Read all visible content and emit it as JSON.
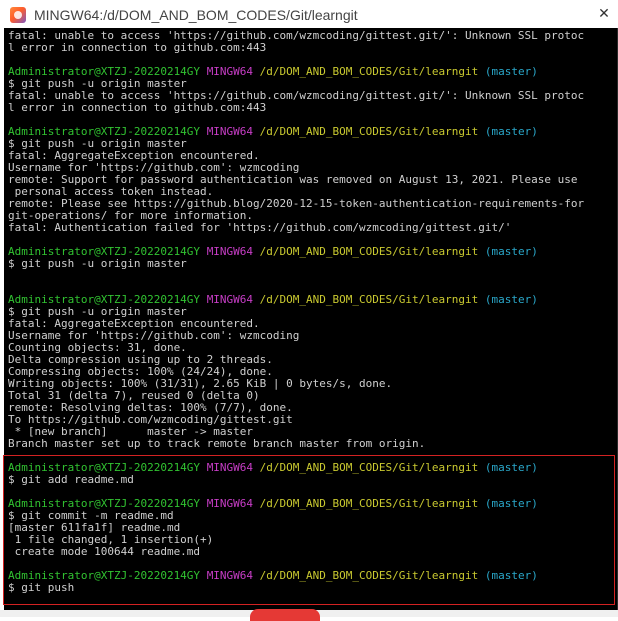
{
  "window": {
    "title": "MINGW64:/d/DOM_AND_BOM_CODES/Git/learngit",
    "close_symbol": "✕"
  },
  "highlight_color": "#d32222",
  "terminal_lines": [
    {
      "text": "fatal: unable to access 'https://github.com/wzmcoding/gittest.git/': Unknown SSL protoc"
    },
    {
      "text": "l error in connection to github.com:443"
    },
    {
      "text": ""
    },
    {
      "prompt": {
        "user": "Administrator@XTZJ-20220214GY",
        "msys": "MINGW64",
        "path": "/d/DOM_AND_BOM_CODES/Git/learngit",
        "branch": "(master)"
      }
    },
    {
      "text": "$ git push -u origin master"
    },
    {
      "text": "fatal: unable to access 'https://github.com/wzmcoding/gittest.git/': Unknown SSL protoc"
    },
    {
      "text": "l error in connection to github.com:443"
    },
    {
      "text": ""
    },
    {
      "prompt": {
        "user": "Administrator@XTZJ-20220214GY",
        "msys": "MINGW64",
        "path": "/d/DOM_AND_BOM_CODES/Git/learngit",
        "branch": "(master)"
      }
    },
    {
      "text": "$ git push -u origin master"
    },
    {
      "text": "fatal: AggregateException encountered."
    },
    {
      "text": "Username for 'https://github.com': wzmcoding"
    },
    {
      "text": "remote: Support for password authentication was removed on August 13, 2021. Please use"
    },
    {
      "text": " personal access token instead."
    },
    {
      "text": "remote: Please see https://github.blog/2020-12-15-token-authentication-requirements-for"
    },
    {
      "text": "git-operations/ for more information."
    },
    {
      "text": "fatal: Authentication failed for 'https://github.com/wzmcoding/gittest.git/'"
    },
    {
      "text": ""
    },
    {
      "prompt": {
        "user": "Administrator@XTZJ-20220214GY",
        "msys": "MINGW64",
        "path": "/d/DOM_AND_BOM_CODES/Git/learngit",
        "branch": "(master)"
      }
    },
    {
      "text": "$ git push -u origin master"
    },
    {
      "text": ""
    },
    {
      "text": ""
    },
    {
      "prompt": {
        "user": "Administrator@XTZJ-20220214GY",
        "msys": "MINGW64",
        "path": "/d/DOM_AND_BOM_CODES/Git/learngit",
        "branch": "(master)"
      }
    },
    {
      "text": "$ git push -u origin master"
    },
    {
      "text": "fatal: AggregateException encountered."
    },
    {
      "text": "Username for 'https://github.com': wzmcoding"
    },
    {
      "text": "Counting objects: 31, done."
    },
    {
      "text": "Delta compression using up to 2 threads."
    },
    {
      "text": "Compressing objects: 100% (24/24), done."
    },
    {
      "text": "Writing objects: 100% (31/31), 2.65 KiB | 0 bytes/s, done."
    },
    {
      "text": "Total 31 (delta 7), reused 0 (delta 0)"
    },
    {
      "text": "remote: Resolving deltas: 100% (7/7), done."
    },
    {
      "text": "To https://github.com/wzmcoding/gittest.git"
    },
    {
      "text": " * [new branch]      master -> master"
    },
    {
      "text": "Branch master set up to track remote branch master from origin."
    },
    {
      "text": ""
    },
    {
      "prompt": {
        "user": "Administrator@XTZJ-20220214GY",
        "msys": "MINGW64",
        "path": "/d/DOM_AND_BOM_CODES/Git/learngit",
        "branch": "(master)"
      }
    },
    {
      "text": "$ git add readme.md"
    },
    {
      "text": ""
    },
    {
      "prompt": {
        "user": "Administrator@XTZJ-20220214GY",
        "msys": "MINGW64",
        "path": "/d/DOM_AND_BOM_CODES/Git/learngit",
        "branch": "(master)"
      }
    },
    {
      "text": "$ git commit -m readme.md"
    },
    {
      "text": "[master 611fa1f] readme.md"
    },
    {
      "text": " 1 file changed, 1 insertion(+)"
    },
    {
      "text": " create mode 100644 readme.md"
    },
    {
      "text": ""
    },
    {
      "prompt": {
        "user": "Administrator@XTZJ-20220214GY",
        "msys": "MINGW64",
        "path": "/d/DOM_AND_BOM_CODES/Git/learngit",
        "branch": "(master)"
      }
    },
    {
      "text": "$ git push"
    }
  ]
}
